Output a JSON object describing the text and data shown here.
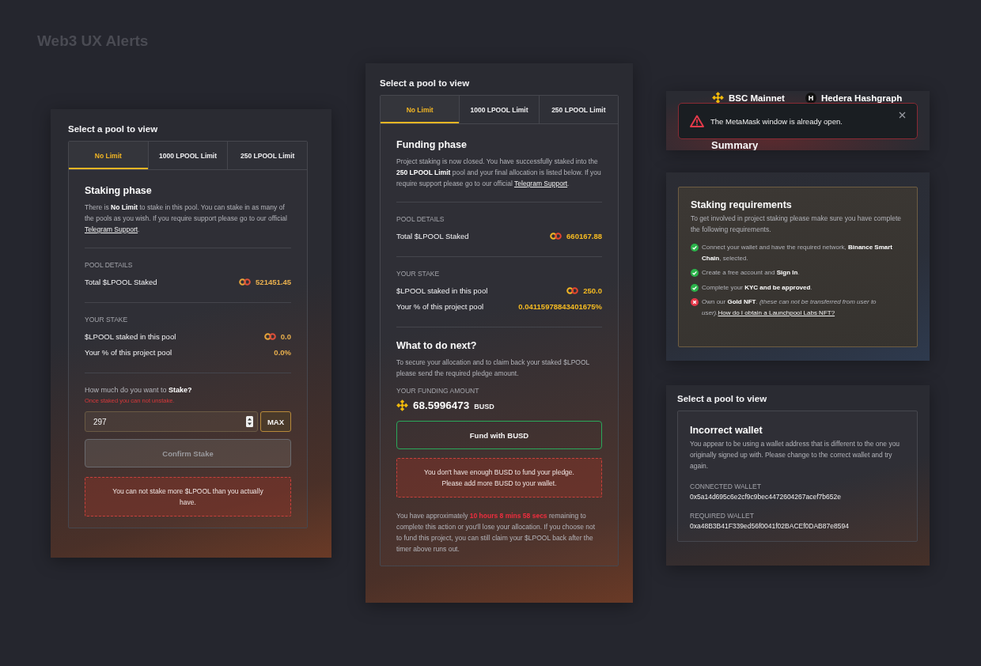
{
  "page_title": "Web3 UX Alerts",
  "staking_panel": {
    "heading": "Select a pool to view",
    "tabs": [
      {
        "label": "No Limit",
        "selected": true
      },
      {
        "label": "1000 LPOOL Limit",
        "selected": false
      },
      {
        "label": "250 LPOOL Limit",
        "selected": false
      }
    ],
    "title": "Staking phase",
    "intro": {
      "text": "There is **No Limit** to stake in this pool. You can stake in as many of the pools as you wish. If you require support please go to our official",
      "link": "Telegram Support",
      "after": "."
    },
    "sections": [
      {
        "label": "POOL DETAILS",
        "rows": [
          {
            "label": "Total $LPOOL Staked",
            "value": "521451.45",
            "token_icon": true
          }
        ]
      },
      {
        "label": "YOUR STAKE",
        "rows": [
          {
            "label": "$LPOOL staked in this pool",
            "value": "0.0",
            "token_icon": true
          },
          {
            "label": "Your % of this project pool",
            "value": "0.0%",
            "token_icon": false
          }
        ]
      }
    ],
    "stake_prompt": "How much do you want to **Stake?**",
    "stake_warning": "Once staked you can not unstake.",
    "amount": {
      "value": "297"
    },
    "max_button": "MAX",
    "confirm_button": {
      "label": "Confirm Stake",
      "disabled": true
    },
    "error": "You can not stake more $LPOOL than you actually have."
  },
  "funding_panel": {
    "heading": "Select a pool to view",
    "tabs": [
      {
        "label": "No Limit",
        "selected": true
      },
      {
        "label": "1000 LPOOL Limit",
        "selected": false
      },
      {
        "label": "250 LPOOL Limit",
        "selected": false
      }
    ],
    "title": "Funding phase",
    "intro": {
      "text": "Project staking is now closed. You have successfully staked into the **250 LPOOL Limit** pool and your final allocation is listed below. If you require support please go to our official",
      "link": "Telegram Support",
      "after": "."
    },
    "sections": [
      {
        "label": "POOL DETAILS",
        "rows": [
          {
            "label": "Total $LPOOL Staked",
            "value": "660167.88",
            "token_icon": true
          }
        ]
      },
      {
        "label": "YOUR STAKE",
        "rows": [
          {
            "label": "$LPOOL staked in this pool",
            "value": "250.0",
            "token_icon": true
          },
          {
            "label": "Your % of this project pool",
            "value": "0.04115978843401675%",
            "token_icon": false
          }
        ]
      }
    ],
    "next_title": "What to do next?",
    "next_text": "To secure your allocation and to claim back your staked $LPOOL please send the required pledge amount.",
    "funding_label": "YOUR FUNDING AMOUNT",
    "funding_amount": "68.5996473",
    "funding_currency": "BUSD",
    "fund_button": {
      "label": "Fund with BUSD",
      "disabled": false
    },
    "error": "You don't have enough BUSD to fund your pledge.\nPlease add more BUSD to your wallet.",
    "timer_note": {
      "before": "You have approximately",
      "timer": "10 hours 8 mins 58 secs",
      "after": "remaining to complete this action or you'll lose your allocation. If you choose not to fund this project, you can still claim your $LPOOL back after the timer above runs out."
    }
  },
  "network_panel": {
    "networks": [
      {
        "name": "BSC Mainnet",
        "kind": "binance"
      },
      {
        "name": "Hedera Hashgraph",
        "kind": "hedera",
        "badge": "H"
      }
    ],
    "toast": {
      "message": "The MetaMask window is already open."
    },
    "section_title": "Summary"
  },
  "requirements_panel": {
    "title": "Staking requirements",
    "intro": "To get involved in project staking please make sure you have complete the following requirements.",
    "items": [
      {
        "text": "Connect your wallet and have the required network, **Binance Smart Chain**, selected.",
        "checked": true
      },
      {
        "text": "Create a free account and **Sign In**.",
        "checked": true
      },
      {
        "text": "Complete your **KYC and be approved**.",
        "checked": true
      },
      {
        "text": "Own our **Gold NFT**. *(these can not be transferred from user to user).*",
        "checked": false,
        "link": "How do I obtain a Launchpool Labs NFT?"
      }
    ]
  },
  "wallet_panel": {
    "heading": "Select a pool to view",
    "title": "Incorrect wallet",
    "text": "You appear to be using a wallet address that is different to the one you originally signed up with. Please change to the correct wallet and try again.",
    "fields": [
      {
        "label": "CONNECTED WALLET",
        "value": "0x5a14d695c6e2cf9c9bec4472604267acef7b652e"
      },
      {
        "label": "REQUIRED WALLET",
        "value": "0xa48B3B41F339ed56f0041f02BACEf0DAB87e8594"
      }
    ]
  }
}
